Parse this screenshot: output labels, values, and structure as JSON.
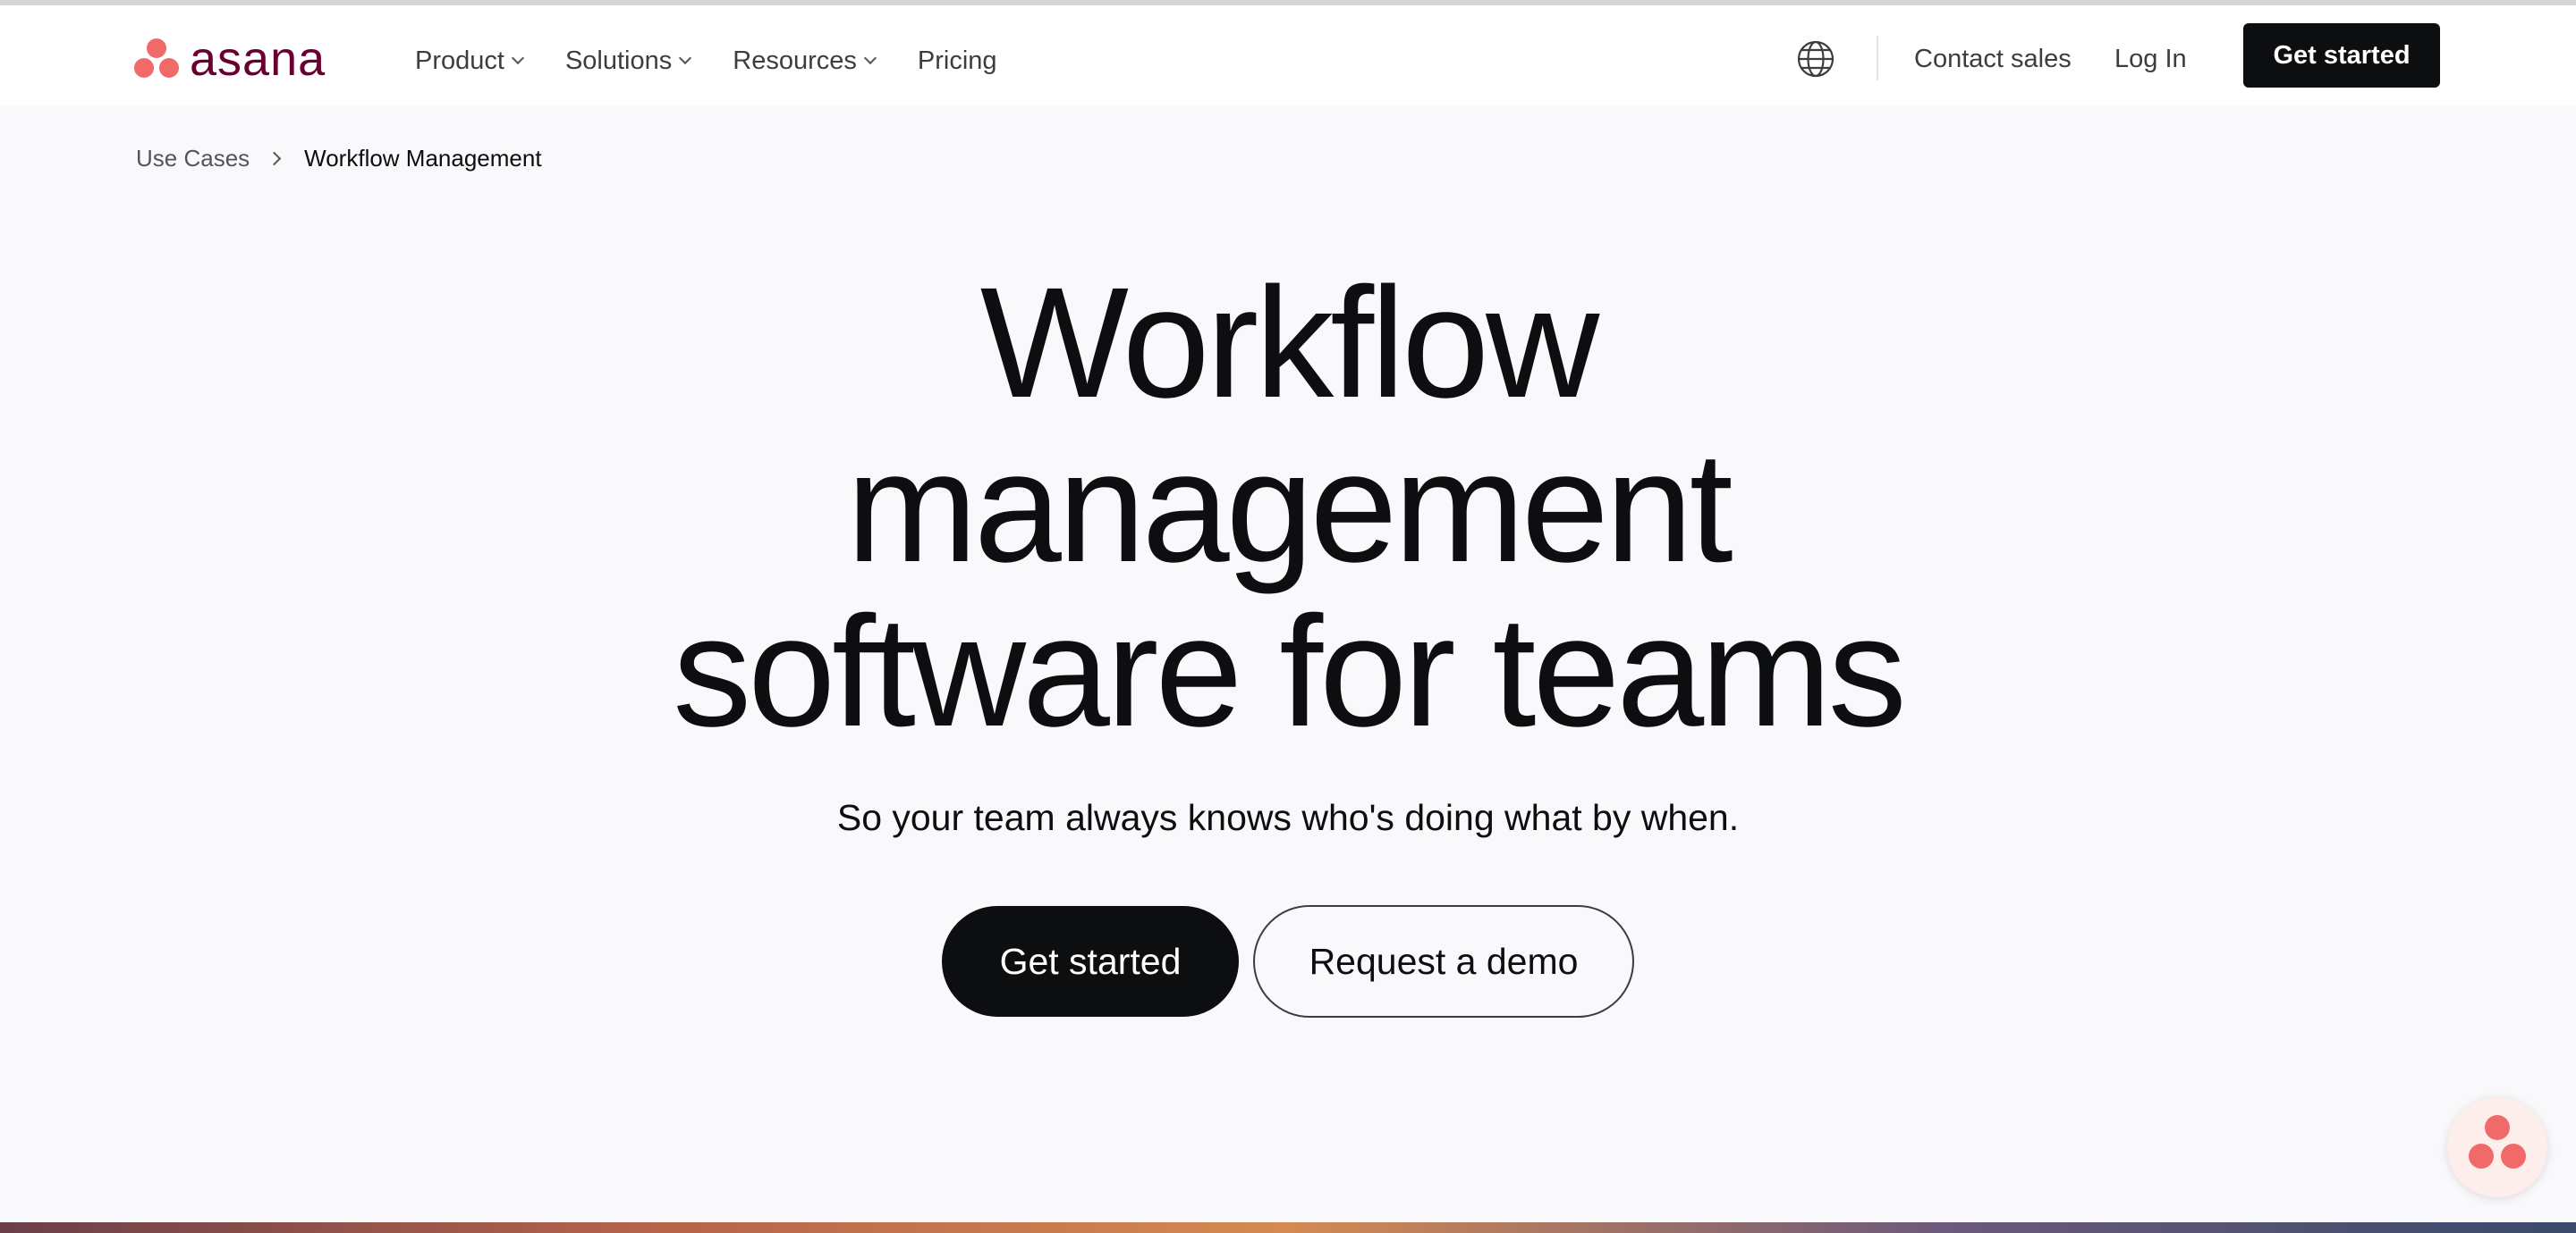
{
  "header": {
    "logo_text": "asana",
    "nav": [
      {
        "label": "Product",
        "has_dropdown": true
      },
      {
        "label": "Solutions",
        "has_dropdown": true
      },
      {
        "label": "Resources",
        "has_dropdown": true
      },
      {
        "label": "Pricing",
        "has_dropdown": false
      }
    ],
    "language_icon": "globe-icon",
    "contact_label": "Contact sales",
    "login_label": "Log In",
    "cta_label": "Get started"
  },
  "breadcrumb": {
    "parent": "Use Cases",
    "current": "Workflow Management"
  },
  "hero": {
    "title_lines": [
      "Workflow",
      "management",
      "software for teams"
    ],
    "subtitle": "So your team always knows who's doing what by when.",
    "primary_cta": "Get started",
    "secondary_cta": "Request a demo"
  },
  "chat_widget_icon": "asana-dots-icon",
  "colors": {
    "brand_coral": "#f06a6a",
    "brand_wordmark": "#690031",
    "text_dark": "#0d0e10",
    "page_bg": "#f9f8fa"
  }
}
